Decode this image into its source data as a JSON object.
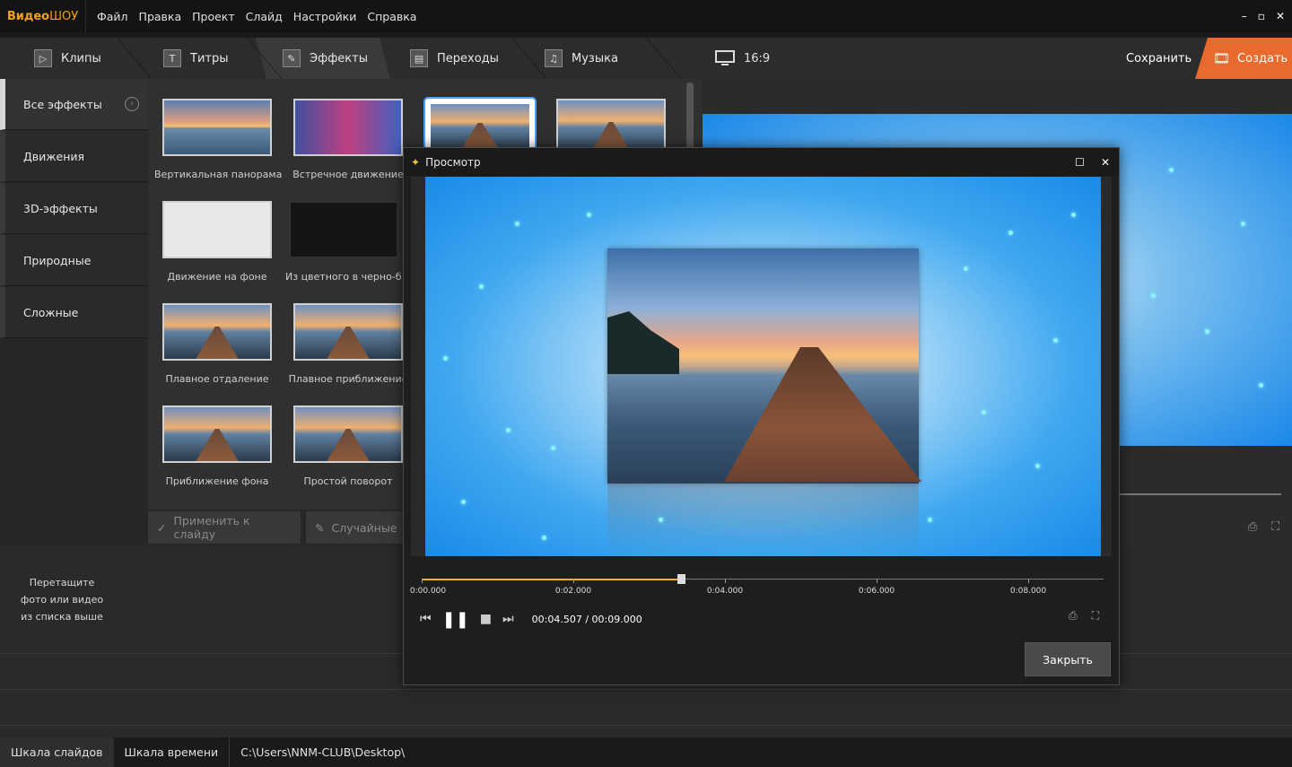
{
  "app": {
    "logo_a": "Видео",
    "logo_b": "ШОУ"
  },
  "menu": [
    "Файл",
    "Правка",
    "Проект",
    "Слайд",
    "Настройки",
    "Справка"
  ],
  "window_controls": {
    "minimize": "–",
    "restore": "▫",
    "close": "✕"
  },
  "tabs": [
    {
      "label": "Клипы",
      "icon": "play-icon",
      "glyph": "▷"
    },
    {
      "label": "Титры",
      "icon": "text-icon",
      "glyph": "T"
    },
    {
      "label": "Эффекты",
      "icon": "magic-wand-icon",
      "glyph": "✎"
    },
    {
      "label": "Переходы",
      "icon": "clapper-icon",
      "glyph": "▤"
    },
    {
      "label": "Музыка",
      "icon": "music-icon",
      "glyph": "♫"
    }
  ],
  "toolbar_right": {
    "ratio": "16:9",
    "save": "Сохранить",
    "create": "Создать"
  },
  "categories": [
    {
      "label": "Все эффекты",
      "active": true
    },
    {
      "label": "Движения",
      "active": false
    },
    {
      "label": "3D-эффекты",
      "active": false
    },
    {
      "label": "Природные",
      "active": false
    },
    {
      "label": "Сложные",
      "active": false
    }
  ],
  "effects": [
    {
      "label": "Вертикальная панорама",
      "style": "t-sunset"
    },
    {
      "label": "Встречное движение",
      "style": "t-purple"
    },
    {
      "label": "",
      "style": "t-white",
      "selected": true
    },
    {
      "label": "",
      "style": "t-dock"
    },
    {
      "label": "Движение на фоне",
      "style": "t-white"
    },
    {
      "label": "Из цветного в черно-белое",
      "style": "t-dark"
    },
    {
      "label": "Плавное отдаление",
      "style": "t-dock"
    },
    {
      "label": "Плавное приближение",
      "style": "t-dock"
    },
    {
      "label": "Приближение фона",
      "style": "t-dock"
    },
    {
      "label": "Простой поворот",
      "style": "t-dock"
    }
  ],
  "apply_buttons": {
    "apply": "Применить к слайду",
    "random": "Случайные"
  },
  "hint": [
    "Перетащите",
    "фото или видео",
    "из списка выше"
  ],
  "statusbar": {
    "slides": "Шкала слайдов",
    "timeline": "Шкала времени",
    "path": "C:\\Users\\NNM-CLUB\\Desktop\\"
  },
  "dialog": {
    "title": "Просмотр",
    "ticks": [
      "0:00.000",
      "0:02.000",
      "0:04.000",
      "0:06.000",
      "0:08.000"
    ],
    "current_time": "00:04.507",
    "total_time": "00:09.000",
    "progress": 0.5,
    "close": "Закрыть"
  },
  "colors": {
    "accent": "#e86a2c",
    "logo": "#f0a21e",
    "progress": "#f0b030"
  }
}
